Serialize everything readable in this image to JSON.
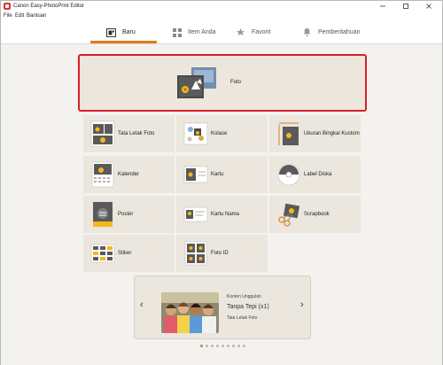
{
  "window": {
    "title": "Canon Easy-PhotoPrint Editor"
  },
  "menu": [
    "File",
    "Edit",
    "Bantuan"
  ],
  "tabs": [
    {
      "label": "Baru",
      "icon": "new-layout-icon",
      "active": true
    },
    {
      "label": "Item Anda",
      "icon": "grid-icon",
      "active": false
    },
    {
      "label": "Favorit",
      "icon": "star-icon",
      "active": false
    },
    {
      "label": "Pemberitahuan",
      "icon": "bell-icon",
      "active": false
    }
  ],
  "featured": {
    "label": "Foto",
    "icon": "photo-icon"
  },
  "grid": [
    {
      "label": "Tata Letak Foto",
      "icon": "photo-layout-icon"
    },
    {
      "label": "Kolase",
      "icon": "collage-icon"
    },
    {
      "label": "Ukuran Bingkai Kustom",
      "icon": "custom-frame-size-icon"
    },
    {
      "label": "Kalender",
      "icon": "calendar-icon"
    },
    {
      "label": "Kartu",
      "icon": "card-icon"
    },
    {
      "label": "Label Diska",
      "icon": "disc-label-icon"
    },
    {
      "label": "Poster",
      "icon": "poster-icon"
    },
    {
      "label": "Kartu Nama",
      "icon": "business-card-icon"
    },
    {
      "label": "Scrapbook",
      "icon": "scrapbook-icon"
    },
    {
      "label": "Stiker",
      "icon": "sticker-icon"
    },
    {
      "label": "Foto ID",
      "icon": "id-photo-icon"
    }
  ],
  "banner": {
    "subtitle": "Konten Unggulan",
    "title": "Tanpa Tepi (x1)",
    "category": "Tata Letak Foto",
    "prev": "‹",
    "next": "›",
    "page_count": 9,
    "active_page": 1
  },
  "colors": {
    "accent": "#e07a1c",
    "selection": "#d81f2a",
    "background": "#f4f2ef",
    "tile": "#ebe6de"
  }
}
